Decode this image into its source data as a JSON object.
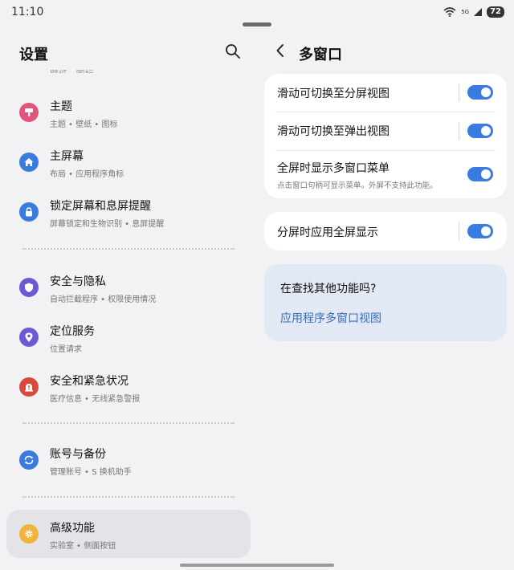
{
  "status_bar": {
    "time": "11:10",
    "network": "5G",
    "battery": "72"
  },
  "left": {
    "title": "设置",
    "cut_text": "壁纸 · 图标",
    "items": [
      {
        "title": "主题",
        "subtitle": "主题 • 壁纸 • 图标",
        "icon": "brush-icon",
        "color": "#e0567a"
      },
      {
        "title": "主屏幕",
        "subtitle": "布局 • 应用程序角标",
        "icon": "home-icon",
        "color": "#3a7be0"
      },
      {
        "title": "锁定屏幕和息屏提醒",
        "subtitle": "屏幕锁定和生物识别 • 息屏提醒",
        "icon": "lock-icon",
        "color": "#3a7be0"
      },
      {
        "title": "安全与隐私",
        "subtitle": "自动拦截程序 • 权限使用情况",
        "icon": "shield-icon",
        "color": "#6b5ad6"
      },
      {
        "title": "定位服务",
        "subtitle": "位置请求",
        "icon": "location-icon",
        "color": "#6b5ad6"
      },
      {
        "title": "安全和紧急状况",
        "subtitle": "医疗信息 • 无线紧急警报",
        "icon": "alert-icon",
        "color": "#d94a3d"
      },
      {
        "title": "账号与备份",
        "subtitle": "管理账号 • S 换机助手",
        "icon": "sync-icon",
        "color": "#3a7be0"
      },
      {
        "title": "高级功能",
        "subtitle": "实验室 • 侧面按钮",
        "icon": "gear-icon",
        "color": "#f0b43c"
      }
    ]
  },
  "right": {
    "title": "多窗口",
    "toggles": [
      {
        "title": "滑动可切换至分屏视图",
        "subtitle": "",
        "on": true
      },
      {
        "title": "滑动可切换至弹出视图",
        "subtitle": "",
        "on": true
      },
      {
        "title": "全屏时显示多窗口菜单",
        "subtitle": "点击窗口句柄可显示菜单。外屏不支持此功能。",
        "on": true
      },
      {
        "title": "分屏时应用全屏显示",
        "subtitle": "",
        "on": true
      }
    ],
    "suggest": {
      "title": "在查找其他功能吗?",
      "link": "应用程序多窗口视图"
    }
  },
  "colors": {
    "accent": "#3a7be0",
    "link": "#3a6fb8",
    "background": "#f2f2f5"
  }
}
